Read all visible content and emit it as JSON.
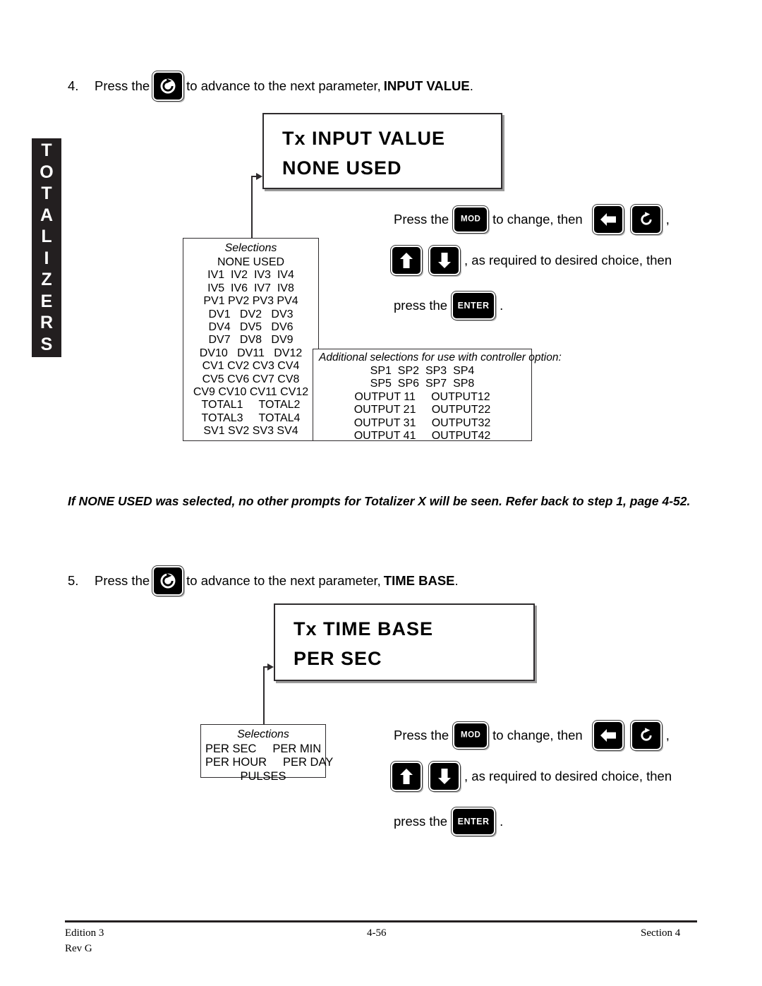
{
  "page": {
    "side_tab_letters": [
      "T",
      "O",
      "T",
      "A",
      "L",
      "I",
      "Z",
      "E",
      "R",
      "S"
    ],
    "side_tab_text": "TOTALIZERS"
  },
  "step4": {
    "number": "4.",
    "text_before": "Press the",
    "text_after": "to advance to the next parameter,",
    "parameter": "INPUT VALUE",
    "period": ".",
    "key": "loop-arrow-key"
  },
  "display1": {
    "line1": "Tx INPUT VALUE",
    "line2": "NONE USED"
  },
  "selections1": {
    "title": "Selections",
    "rows": [
      "NONE USED",
      "IV1  IV2  IV3  IV4",
      "IV5  IV6  IV7  IV8",
      "PV1 PV2 PV3 PV4",
      "DV1   DV2   DV3",
      "DV4   DV5   DV6",
      "DV7   DV8   DV9",
      "DV10   DV11   DV12",
      "CV1 CV2 CV3 CV4",
      "CV5 CV6 CV7 CV8",
      "CV9 CV10 CV11 CV12",
      "TOTAL1     TOTAL2",
      "TOTAL3     TOTAL4",
      "SV1 SV2 SV3 SV4"
    ]
  },
  "additional_selections": {
    "title": "Additional selections for use with controller option:",
    "rows": [
      "SP1  SP2  SP3  SP4",
      "SP5  SP6  SP7  SP8",
      "OUTPUT 11     OUTPUT12",
      "OUTPUT 21     OUTPUT22",
      "OUTPUT 31     OUTPUT32",
      "OUTPUT 41     OUTPUT42"
    ]
  },
  "instructions1": {
    "line1_a": "Press the",
    "line1_b": "to change, then",
    "line1_comma": ",",
    "line2_a": ", as required to desired choice, then",
    "line3_a": "press the",
    "line3_period": ".",
    "keys": {
      "mod": "MOD",
      "enter": "ENTER",
      "left_arrow": "left-arrow-key",
      "loop": "loop-arrow-key",
      "up_arrow": "up-arrow-key",
      "down_arrow": "down-arrow-key"
    }
  },
  "note": {
    "text": "If NONE USED was selected, no other prompts for Totalizer X will be seen.  Refer back to step 1, page 4-52."
  },
  "step5": {
    "number": "5.",
    "text_before": "Press the",
    "text_after": "to advance to the next parameter,",
    "parameter": "TIME BASE",
    "period": ".",
    "key": "loop-arrow-key"
  },
  "display2": {
    "line1": "Tx TIME BASE",
    "line2": "PER SEC"
  },
  "selections2": {
    "title": "Selections",
    "rows": [
      "PER SEC     PER MIN",
      "PER HOUR     PER DAY",
      "PULSES"
    ]
  },
  "instructions2": {
    "line1_a": "Press the",
    "line1_b": "to change, then",
    "line1_comma": ",",
    "line2_a": ", as required to desired choice, then",
    "line3_a": "press the",
    "line3_period": ".",
    "keys": {
      "mod": "MOD",
      "enter": "ENTER",
      "left_arrow": "left-arrow-key",
      "loop": "loop-arrow-key",
      "up_arrow": "up-arrow-key",
      "down_arrow": "down-arrow-key"
    }
  },
  "footer": {
    "edition": "Edition 3",
    "rev": "Rev G",
    "page_number": "4-56",
    "section": "Section 4"
  },
  "colors": {
    "ink": "#231f20",
    "rule": "#2e2b2d",
    "paper": "#ffffff"
  }
}
